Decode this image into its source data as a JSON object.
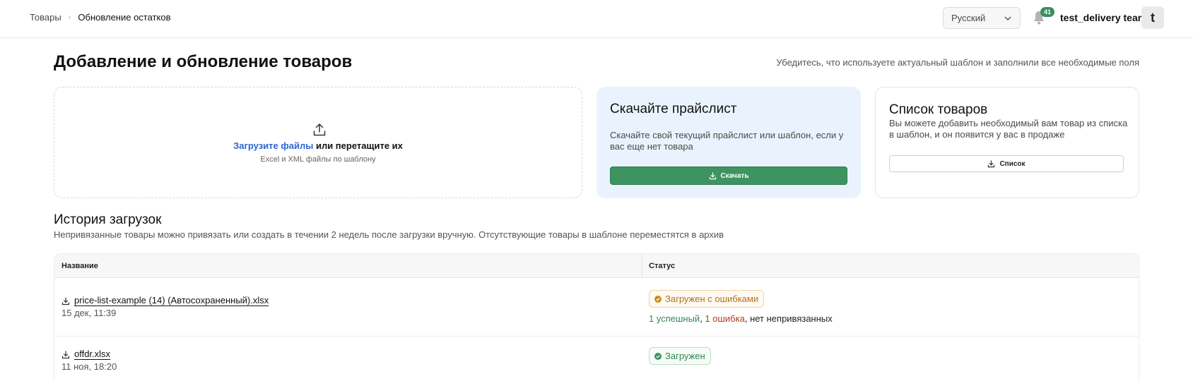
{
  "header": {
    "breadcrumb_prev": "Товары",
    "breadcrumb_sep": "›",
    "breadcrumb_current": "Обновление остатков",
    "language": "Русский",
    "notifications_count": "41",
    "user_name": "test_delivery team",
    "avatar_letter": "t"
  },
  "page": {
    "title": "Добавление и обновление товаров",
    "hint": "Убедитесь, что используете актуальный шаблон и заполнили все необходимые поля"
  },
  "upload": {
    "link_text": "Загрузите файлы",
    "rest_text": " или перетащите их",
    "subtext": "Excel и XML файлы по шаблону"
  },
  "price_card": {
    "title": "Скачайте прайслист",
    "text": "Скачайте свой текущий прайслист или шаблон, если у вас еще нет товара",
    "button": "Скачать"
  },
  "list_card": {
    "title": "Список товаров",
    "text": "Вы можете добавить необходимый вам товар из списка в шаблон, и он появится у вас в продаже",
    "button": "Список"
  },
  "history": {
    "title": "История загрузок",
    "subtitle": "Непривязанные товары можно привязать или создать в течении 2 недель после загрузки вручную. Отсутствующие товары в шаблоне переместятся в архив",
    "columns": [
      "Название",
      "Статус"
    ],
    "rows": [
      {
        "file": "price-list-example (14) (Автосохраненный).xlsx",
        "date": "15 дек, 11:39",
        "status": "Загружен с ошибками",
        "stat_ok": "1 успешный",
        "stat_sep1": ", ",
        "stat_err": "1 ошибка",
        "stat_sep2": ", ",
        "stat_none": "нет непривязанных"
      },
      {
        "file": "offdr.xlsx",
        "date": "11 ноя, 18:20",
        "status": "Загружен"
      }
    ]
  },
  "colors": {
    "accent_green": "#3d9461",
    "link_blue": "#2a66d4",
    "warning_orange": "#b0711a",
    "error_red": "#b0391a",
    "card_blue": "#eaf3fd"
  },
  "icons": {
    "upload": "upload-icon",
    "download": "download-icon",
    "bell": "bell-icon",
    "chevron": "chevron-down-icon",
    "warning": "warning-dot-icon",
    "success": "check-dot-icon"
  }
}
